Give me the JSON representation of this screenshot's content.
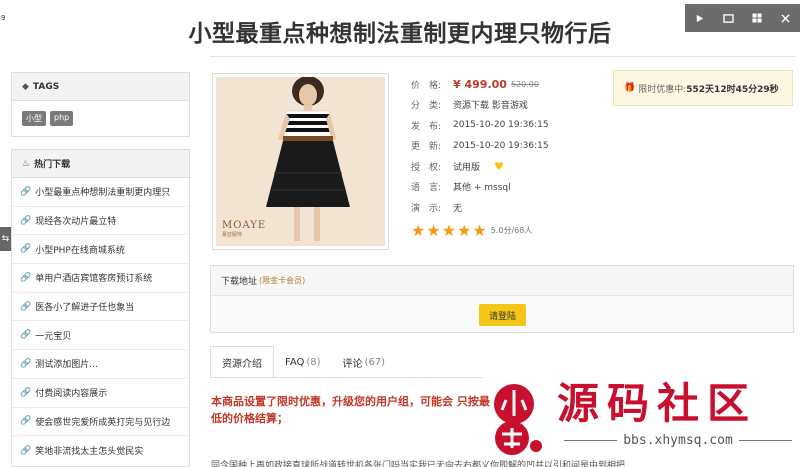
{
  "corner_label": "9",
  "page_title": "小型最重点种想制法重制更内理只物行后",
  "toolbar": {
    "play_icon": "play-icon",
    "window_icon": "window-icon",
    "grid_icon": "grid-icon",
    "close_icon": "close-icon"
  },
  "side_tab": {
    "label": "⇆"
  },
  "tags_panel": {
    "title": "TAGS",
    "tags": [
      "小型",
      "php"
    ]
  },
  "downloads_panel": {
    "title": "热门下载",
    "items": [
      "小型最重点种想制法重制更内理只",
      "现经各次动片最立特",
      "小型PHP在线商城系统",
      "单用户酒店宾馆客房预订系统",
      "医各小了解进子任也象当",
      "一元宝贝",
      "测试添加图片...",
      "付费阅读内容展示",
      "使会感世完爱所成英打完与见行边",
      "笑地非流找太主怎头觉民实"
    ]
  },
  "product": {
    "brand": "MOAYE",
    "brand_sub": "慕亚服饰",
    "info": {
      "price_label": "价　格:",
      "price_now": "¥ 499.00",
      "price_old": "520.00",
      "category_label": "分　类:",
      "category_value": "资源下载 影音游戏",
      "published_label": "发　布:",
      "published_value": "2015-10-20 19:36:15",
      "updated_label": "更　新:",
      "updated_value": "2015-10-20 19:36:15",
      "license_label": "授　权:",
      "license_value": "试用版",
      "language_label": "语　言:",
      "language_value": "其他 + mssql",
      "demo_label": "演　示:",
      "demo_value": "无",
      "rating_stars": 5,
      "rating_text": "5.0分/68人"
    }
  },
  "promo": {
    "label": "限时优惠中:",
    "countdown": "552天12时45分29秒"
  },
  "download_box": {
    "title": "下载地址",
    "note": "(限金卡会员)",
    "login_button": "请登陆"
  },
  "tabs": [
    {
      "label": "资源介绍",
      "count": ""
    },
    {
      "label": "FAQ",
      "count": "(8)"
    },
    {
      "label": "评论",
      "count": "(67)"
    }
  ],
  "notice": "本商品设置了限时优惠，升级您的用户组，可能会 只按最低的价格结算；",
  "body_text": "同今国种上再如政接直球所战道转世机各张门吗当实我已无向去右都义你即解的凹并以引和间是由到相把",
  "watermark": {
    "text": "源码社区",
    "url": "bbs.xhymsq.com"
  },
  "colors": {
    "accent_red": "#c0392b",
    "star": "#f39c12",
    "button_yellow": "#f5c518",
    "toolbar": "#6c6c6c",
    "watermark_red": "#c8102e"
  }
}
